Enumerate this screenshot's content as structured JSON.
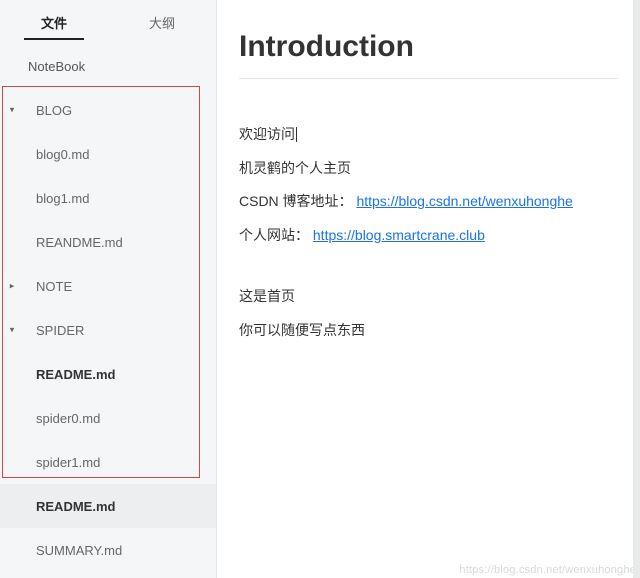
{
  "tabs": {
    "file": "文件",
    "outline": "大纲"
  },
  "tree": {
    "root0": "NoteBook",
    "blog": {
      "label": "BLOG",
      "caret": "▾",
      "items": [
        "blog0.md",
        "blog1.md",
        "REANDME.md"
      ]
    },
    "note": {
      "label": "NOTE",
      "caret": "▸"
    },
    "spider": {
      "label": "SPIDER",
      "caret": "▾",
      "items": [
        "README.md",
        "spider0.md",
        "spider1.md"
      ]
    },
    "footer": [
      "README.md",
      "SUMMARY.md"
    ]
  },
  "article": {
    "title": "Introduction",
    "p1": "欢迎访问",
    "p2": "机灵鹤的个人主页",
    "p3_prefix": "CSDN 博客地址：",
    "p3_link": "https://blog.csdn.net/wenxuhonghe",
    "p4_prefix": "个人网站：",
    "p4_link": "https://blog.smartcrane.club",
    "p5": "这是首页",
    "p6": "你可以随便写点东西"
  },
  "watermark": "https://blog.csdn.net/wenxuhonghe"
}
